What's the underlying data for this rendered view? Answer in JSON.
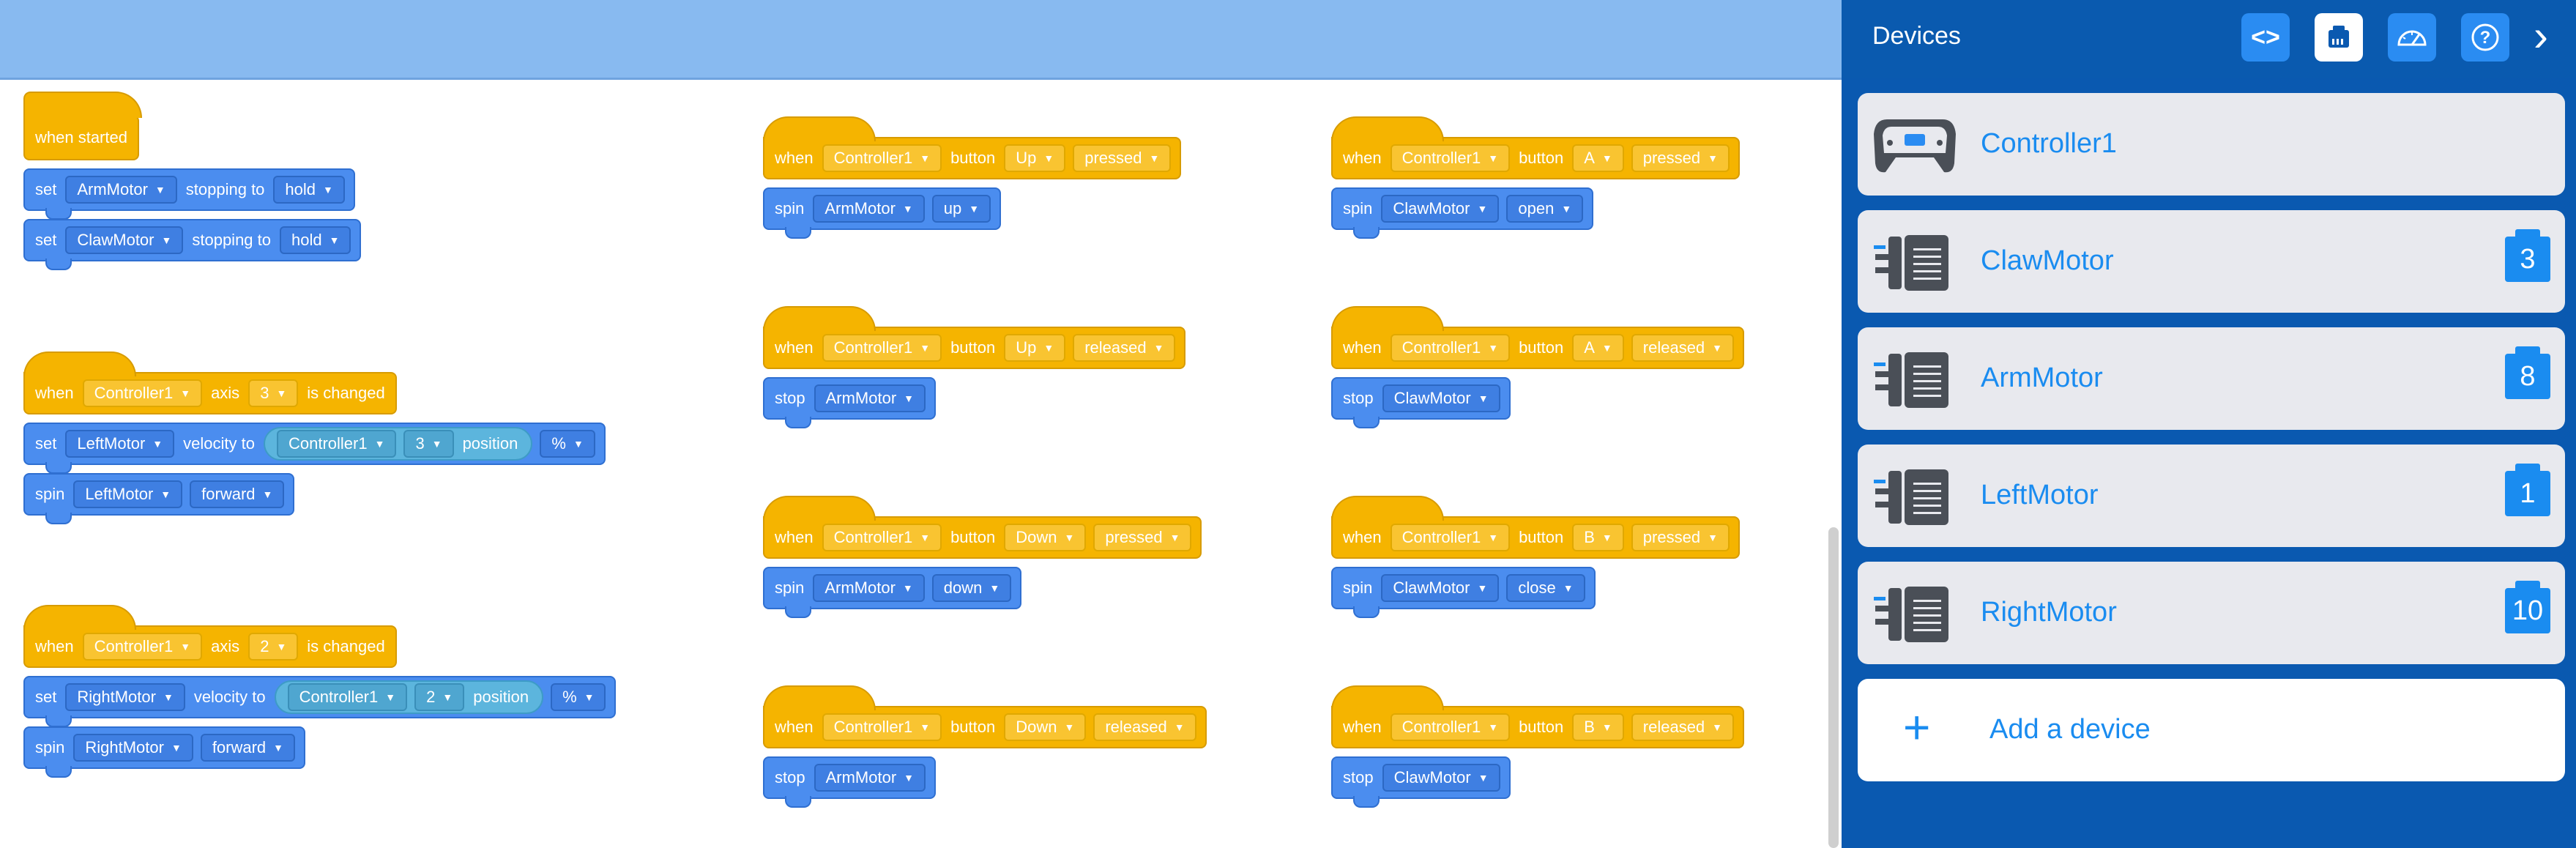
{
  "sidebar": {
    "title": "Devices",
    "header_buttons": [
      {
        "name": "code-view",
        "icon": "code-brackets-icon",
        "glyph": "<>"
      },
      {
        "name": "devices",
        "icon": "device-port-icon",
        "glyph": "▦"
      },
      {
        "name": "dashboard",
        "icon": "gauge-icon",
        "glyph": "◔"
      },
      {
        "name": "help",
        "icon": "help-icon",
        "glyph": "?"
      }
    ],
    "collapse_glyph": "›",
    "devices": [
      {
        "name": "Controller1",
        "icon": "controller-icon",
        "port": ""
      },
      {
        "name": "ClawMotor",
        "icon": "motor-icon",
        "port": "3"
      },
      {
        "name": "ArmMotor",
        "icon": "motor-icon",
        "port": "8"
      },
      {
        "name": "LeftMotor",
        "icon": "motor-icon",
        "port": "1"
      },
      {
        "name": "RightMotor",
        "icon": "motor-icon",
        "port": "10"
      }
    ],
    "add_device_glyph": "+",
    "add_device_label": "Add a device"
  },
  "colors": {
    "event_block": "#f5b400",
    "motion_block": "#4b8def",
    "reporter_block": "#5cb5dd",
    "toolbar": "#88baf0",
    "sidebar": "#0a59b0",
    "accent": "#1a8cf0"
  },
  "blocks": {
    "s1": {
      "hat": "when started",
      "b1": {
        "kw1": "set",
        "dd1": "ArmMotor",
        "kw2": "stopping to",
        "dd2": "hold"
      },
      "b2": {
        "kw1": "set",
        "dd1": "ClawMotor",
        "kw2": "stopping to",
        "dd2": "hold"
      }
    },
    "s2": {
      "hat": {
        "kw1": "when",
        "dd1": "Controller1",
        "kw2": "axis",
        "dd2": "3",
        "kw3": "is changed"
      },
      "b1": {
        "kw1": "set",
        "dd1": "LeftMotor",
        "kw2": "velocity to",
        "rep_dd1": "Controller1",
        "rep_dd2": "3",
        "rep_kw": "position",
        "dd2": "%"
      },
      "b2": {
        "kw1": "spin",
        "dd1": "LeftMotor",
        "dd2": "forward"
      }
    },
    "s3": {
      "hat": {
        "kw1": "when",
        "dd1": "Controller1",
        "kw2": "axis",
        "dd2": "2",
        "kw3": "is changed"
      },
      "b1": {
        "kw1": "set",
        "dd1": "RightMotor",
        "kw2": "velocity to",
        "rep_dd1": "Controller1",
        "rep_dd2": "2",
        "rep_kw": "position",
        "dd2": "%"
      },
      "b2": {
        "kw1": "spin",
        "dd1": "RightMotor",
        "dd2": "forward"
      }
    },
    "s4": {
      "hat": {
        "kw1": "when",
        "dd1": "Controller1",
        "kw2": "button",
        "dd2": "Up",
        "dd3": "pressed"
      },
      "b1": {
        "kw1": "spin",
        "dd1": "ArmMotor",
        "dd2": "up"
      }
    },
    "s5": {
      "hat": {
        "kw1": "when",
        "dd1": "Controller1",
        "kw2": "button",
        "dd2": "Up",
        "dd3": "released"
      },
      "b1": {
        "kw1": "stop",
        "dd1": "ArmMotor"
      }
    },
    "s6": {
      "hat": {
        "kw1": "when",
        "dd1": "Controller1",
        "kw2": "button",
        "dd2": "Down",
        "dd3": "pressed"
      },
      "b1": {
        "kw1": "spin",
        "dd1": "ArmMotor",
        "dd2": "down"
      }
    },
    "s7": {
      "hat": {
        "kw1": "when",
        "dd1": "Controller1",
        "kw2": "button",
        "dd2": "Down",
        "dd3": "released"
      },
      "b1": {
        "kw1": "stop",
        "dd1": "ArmMotor"
      }
    },
    "s8": {
      "hat": {
        "kw1": "when",
        "dd1": "Controller1",
        "kw2": "button",
        "dd2": "A",
        "dd3": "pressed"
      },
      "b1": {
        "kw1": "spin",
        "dd1": "ClawMotor",
        "dd2": "open"
      }
    },
    "s9": {
      "hat": {
        "kw1": "when",
        "dd1": "Controller1",
        "kw2": "button",
        "dd2": "A",
        "dd3": "released"
      },
      "b1": {
        "kw1": "stop",
        "dd1": "ClawMotor"
      }
    },
    "s10": {
      "hat": {
        "kw1": "when",
        "dd1": "Controller1",
        "kw2": "button",
        "dd2": "B",
        "dd3": "pressed"
      },
      "b1": {
        "kw1": "spin",
        "dd1": "ClawMotor",
        "dd2": "close"
      }
    },
    "s11": {
      "hat": {
        "kw1": "when",
        "dd1": "Controller1",
        "kw2": "button",
        "dd2": "B",
        "dd3": "released"
      },
      "b1": {
        "kw1": "stop",
        "dd1": "ClawMotor"
      }
    }
  }
}
